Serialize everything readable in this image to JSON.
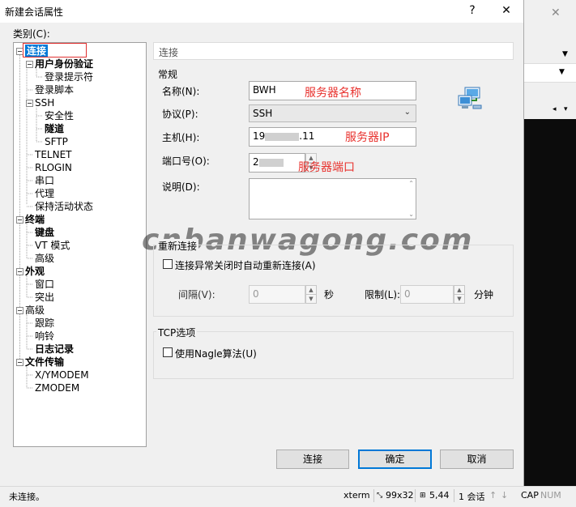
{
  "window": {
    "title": "新建会话属性",
    "help_glyph": "?",
    "close_glyph": "✕"
  },
  "category": {
    "label": "类别(C):",
    "tree": [
      {
        "label": "连接",
        "bold": true,
        "selected": true
      },
      {
        "label": "用户身份验证",
        "bold": true
      },
      {
        "label": "登录提示符",
        "bold": false
      },
      {
        "label": "登录脚本",
        "bold": false
      },
      {
        "label": "SSH",
        "bold": false
      },
      {
        "label": "安全性",
        "bold": false
      },
      {
        "label": "隧道",
        "bold": true
      },
      {
        "label": "SFTP",
        "bold": false
      },
      {
        "label": "TELNET",
        "bold": false
      },
      {
        "label": "RLOGIN",
        "bold": false
      },
      {
        "label": "串口",
        "bold": false
      },
      {
        "label": "代理",
        "bold": false
      },
      {
        "label": "保持活动状态",
        "bold": false
      },
      {
        "label": "终端",
        "bold": true
      },
      {
        "label": "键盘",
        "bold": true
      },
      {
        "label": "VT 模式",
        "bold": false
      },
      {
        "label": "高级",
        "bold": false
      },
      {
        "label": "外观",
        "bold": true
      },
      {
        "label": "窗口",
        "bold": false
      },
      {
        "label": "突出",
        "bold": false
      },
      {
        "label": "高级",
        "bold": false
      },
      {
        "label": "跟踪",
        "bold": false
      },
      {
        "label": "响铃",
        "bold": false
      },
      {
        "label": "日志记录",
        "bold": true
      },
      {
        "label": "文件传输",
        "bold": true
      },
      {
        "label": "X/YMODEM",
        "bold": false
      },
      {
        "label": "ZMODEM",
        "bold": false
      }
    ]
  },
  "panel": {
    "header": "连接",
    "general": {
      "title": "常规",
      "name_label": "名称(N):",
      "name_value": "BWH",
      "name_note": "服务器名称",
      "protocol_label": "协议(P):",
      "protocol_value": "SSH",
      "host_label": "主机(H):",
      "host_value_start": "19",
      "host_value_end": ".11",
      "host_note": "服务器IP",
      "port_label": "端口号(O):",
      "port_value": "2",
      "port_note": "服务器端口",
      "desc_label": "说明(D):",
      "desc_value": ""
    },
    "reconnect": {
      "title": "重新连接",
      "auto_label": "连接异常关闭时自动重新连接(A)",
      "interval_label": "间隔(V):",
      "interval_value": "0",
      "interval_unit": "秒",
      "limit_label": "限制(L):",
      "limit_value": "0",
      "limit_unit": "分钟"
    },
    "tcp": {
      "title": "TCP选项",
      "nagle_label": "使用Nagle算法(U)"
    }
  },
  "buttons": {
    "connect": "连接",
    "ok": "确定",
    "cancel": "取消"
  },
  "watermark": "cnbanwagong.com",
  "status_bar": {
    "left": "未连接。",
    "term": "xterm",
    "size": "99x32",
    "pos": "5,44",
    "sessions": "1 会话",
    "caps": "CAP",
    "num": "NUM"
  },
  "colors": {
    "note": "#e8322e",
    "highlight_box": "#e03030",
    "default_button": "#0078d7"
  }
}
